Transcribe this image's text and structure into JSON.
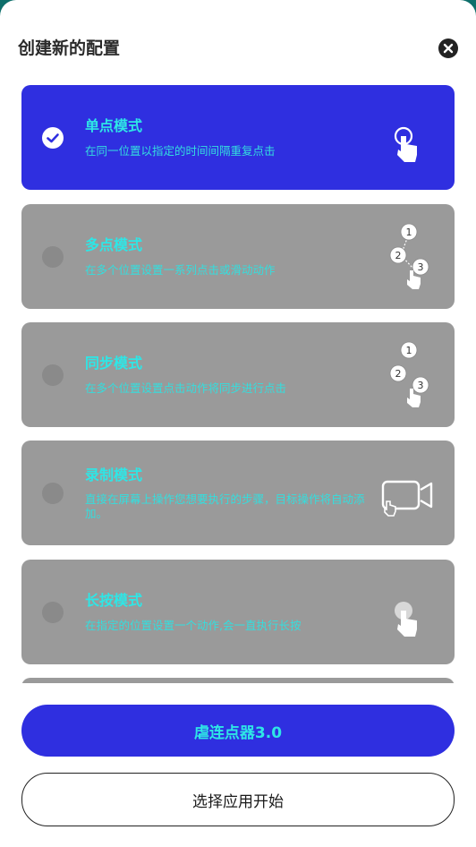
{
  "dialog": {
    "title": "创建新的配置"
  },
  "modes": [
    {
      "title": "单点模式",
      "desc": "在同一位置以指定的时间间隔重复点击",
      "selected": true,
      "icon": "tap-icon"
    },
    {
      "title": "多点模式",
      "desc": "在多个位置设置一系列点击或滑动动作",
      "selected": false,
      "icon": "multi-tap-icon"
    },
    {
      "title": "同步模式",
      "desc": "在多个位置设置点击动作将同步进行点击",
      "selected": false,
      "icon": "sync-tap-icon"
    },
    {
      "title": "录制模式",
      "desc": "直接在屏幕上操作您想要执行的步骤，目标操作将自动添加。",
      "selected": false,
      "icon": "record-icon"
    },
    {
      "title": "长按模式",
      "desc": "在指定的位置设置一个动作,会一直执行长按",
      "selected": false,
      "icon": "long-press-icon"
    }
  ],
  "steps": {
    "n1": "1",
    "n2": "2",
    "n3": "3"
  },
  "actions": {
    "primary_label": "虐连点器3.0",
    "secondary_label": "选择应用开始"
  },
  "colors": {
    "accent": "#2f2fe0",
    "text_accent": "#2ee6e6",
    "card_inactive": "#9a9a9a"
  }
}
